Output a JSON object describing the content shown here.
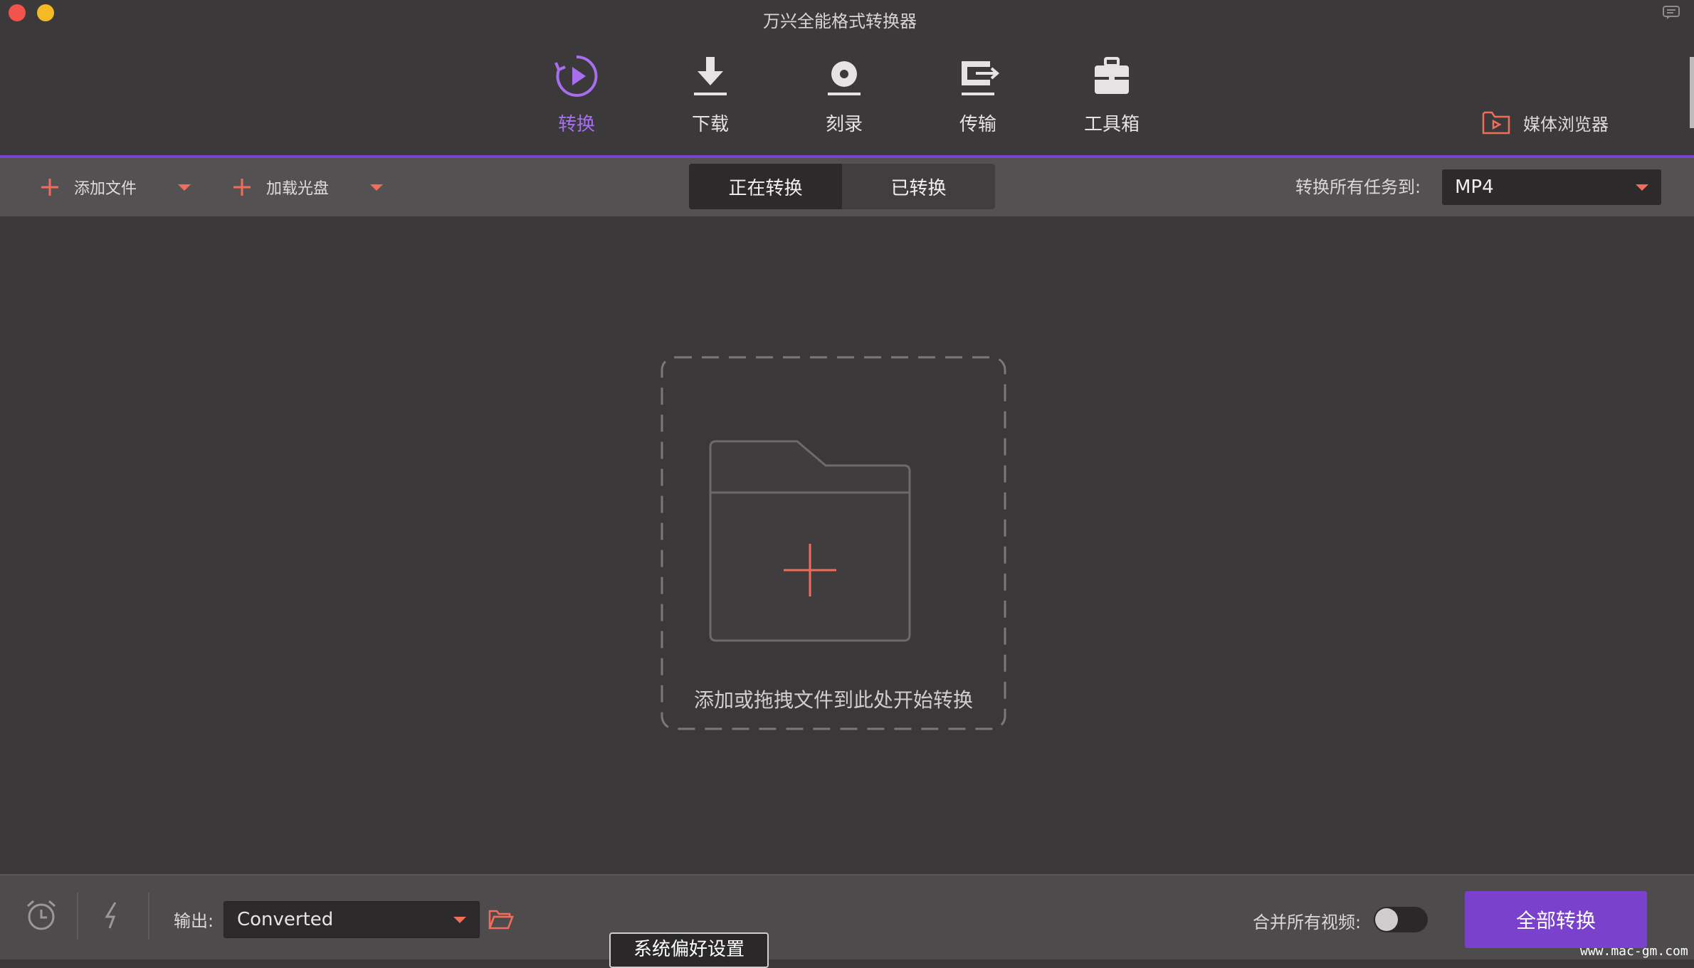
{
  "window": {
    "title": "万兴全能格式转换器"
  },
  "nav": {
    "tabs": [
      {
        "label": "转换",
        "icon": "convert-icon",
        "active": true
      },
      {
        "label": "下载",
        "icon": "download-icon",
        "active": false
      },
      {
        "label": "刻录",
        "icon": "burn-disc-icon",
        "active": false
      },
      {
        "label": "传输",
        "icon": "transfer-icon",
        "active": false
      },
      {
        "label": "工具箱",
        "icon": "toolbox-icon",
        "active": false
      }
    ],
    "media_browser": "媒体浏览器"
  },
  "toolbar": {
    "add_file": "添加文件",
    "load_disc": "加载光盘",
    "segments": [
      "正在转换",
      "已转换"
    ],
    "active_segment": "正在转换",
    "convert_all_to_label": "转换所有任务到:",
    "format": "MP4"
  },
  "main": {
    "drop_hint": "添加或拖拽文件到此处开始转换"
  },
  "bottom": {
    "output_label": "输出:",
    "output_value": "Converted",
    "merge_label": "合并所有视频:",
    "merge_enabled": false,
    "convert_all_button": "全部转换"
  },
  "tooltip": "系统偏好设置",
  "watermark": "www.mac-gm.com",
  "colors": {
    "accent_purple": "#7a42cc",
    "active_tab_text": "#a76ff0",
    "accent_red": "#f26c5b",
    "background": "#3a3839"
  }
}
